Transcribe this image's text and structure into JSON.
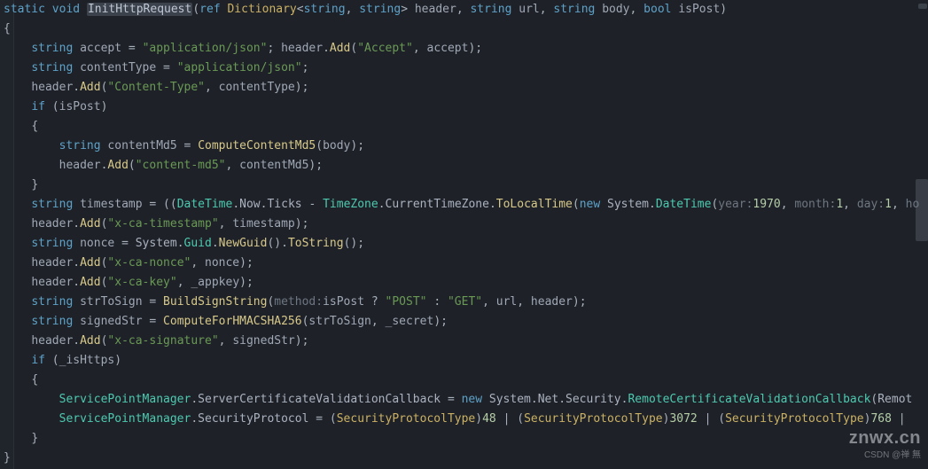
{
  "watermark": {
    "site": "znwx.cn",
    "credit": "CSDN @禅 無"
  },
  "hints": {
    "year": "year:",
    "month": "month:",
    "day": "day:",
    "method": "method:"
  },
  "code": {
    "l1": {
      "k_static": "static",
      "k_void": "void",
      "name": "InitHttpRequest",
      "op_op": "(",
      "k_ref": "ref",
      "t_dict": "Dictionary",
      "op_lt": "<",
      "t_s1": "string",
      "op_c": ",",
      "t_s2": "string",
      "op_gt": ">",
      "p_header": "header",
      "op_c2": ",",
      "t_s3": "string",
      "p_url": "url",
      "op_c3": ",",
      "t_s4": "string",
      "p_body": "body",
      "op_c4": ",",
      "t_bool": "bool",
      "p_isPost": "isPost",
      "op_cp": ")"
    },
    "l2": {
      "br": "{"
    },
    "l3": {
      "t": "string",
      "v": "accept",
      "eq": "=",
      "s": "\"application/json\"",
      "sc": ";",
      "h": "header",
      "dot": ".",
      "add": "Add",
      "op": "(",
      "s2": "\"Accept\"",
      "c": ",",
      "a2": "accept",
      "cp": ")",
      "sc2": ";"
    },
    "l4": {
      "t": "string",
      "v": "contentType",
      "eq": "=",
      "s": "\"application/json\"",
      "sc": ";"
    },
    "l5": {
      "h": "header",
      "dot": ".",
      "add": "Add",
      "op": "(",
      "s": "\"Content-Type\"",
      "c": ",",
      "v": "contentType",
      "cp": ")",
      "sc": ";"
    },
    "l6": {
      "k": "if",
      "op": "(",
      "v": "isPost",
      "cp": ")"
    },
    "l7": {
      "br": "{"
    },
    "l8": {
      "t": "string",
      "v": "contentMd5",
      "eq": "=",
      "fn": "ComputeContentMd5",
      "op": "(",
      "a": "body",
      "cp": ")",
      "sc": ";"
    },
    "l9": {
      "h": "header",
      "dot": ".",
      "add": "Add",
      "op": "(",
      "s": "\"content-md5\"",
      "c": ",",
      "v": "contentMd5",
      "cp": ")",
      "sc": ";"
    },
    "l10": {
      "br": "}"
    },
    "l11": {
      "t": "string",
      "v": "timestamp",
      "eq": "=",
      "op": "((",
      "dt": "DateTime",
      "d": ".",
      "now": "Now",
      "d2": ".",
      "ticks": "Ticks",
      "minus": "-",
      "tz": "TimeZone",
      "d3": ".",
      "cur": "CurrentTimeZone",
      "d4": ".",
      "tlt": "ToLocalTime",
      "op2": "(",
      "new": "new",
      "sp": " ",
      "sys": "System",
      "d5": ".",
      "dt2": "DateTime",
      "op3": "(",
      "y": "1970",
      "c1": ",",
      "m": "1",
      "c2": ",",
      "dd": "1",
      "c3": ",",
      "tail": "ho"
    },
    "l12": {
      "h": "header",
      "dot": ".",
      "add": "Add",
      "op": "(",
      "s": "\"x-ca-timestamp\"",
      "c": ",",
      "v": "timestamp",
      "cp": ")",
      "sc": ";"
    },
    "l13": {
      "t": "string",
      "v": "nonce",
      "eq": "=",
      "sys": "System",
      "d": ".",
      "guid": "Guid",
      "d2": ".",
      "ng": "NewGuid",
      "op": "()",
      "d3": ".",
      "ts": "ToString",
      "op2": "()",
      "sc": ";"
    },
    "l14": {
      "h": "header",
      "dot": ".",
      "add": "Add",
      "op": "(",
      "s": "\"x-ca-nonce\"",
      "c": ",",
      "v": "nonce",
      "cp": ")",
      "sc": ";"
    },
    "l15": {
      "h": "header",
      "dot": ".",
      "add": "Add",
      "op": "(",
      "s": "\"x-ca-key\"",
      "c": ",",
      "v": "_appkey",
      "cp": ")",
      "sc": ";"
    },
    "l16": {
      "t": "string",
      "v": "strToSign",
      "eq": "=",
      "fn": "BuildSignString",
      "op": "(",
      "ip": "isPost",
      "q": "?",
      "s1": "\"POST\"",
      "col": ":",
      "s2": "\"GET\"",
      "c1": ",",
      "u": "url",
      "c2": ",",
      "hd": "header",
      "cp": ")",
      "sc": ";"
    },
    "l17": {
      "t": "string",
      "v": "signedStr",
      "eq": "=",
      "fn": "ComputeForHMACSHA256",
      "op": "(",
      "a": "strToSign",
      "c": ",",
      "sec": "_secret",
      "cp": ")",
      "sc": ";"
    },
    "l18": {
      "h": "header",
      "dot": ".",
      "add": "Add",
      "op": "(",
      "s": "\"x-ca-signature\"",
      "c": ",",
      "v": "signedStr",
      "cp": ")",
      "sc": ";"
    },
    "l19": {
      "k": "if",
      "op": "(",
      "v": "_isHttps",
      "cp": ")"
    },
    "l20": {
      "br": "{"
    },
    "l21": {
      "spm": "ServicePointManager",
      "d": ".",
      "cb": "ServerCertificateValidationCallback",
      "eq": "=",
      "new": "new",
      "sp": " ",
      "sys": "System",
      "d2": ".",
      "net": "Net",
      "d3": ".",
      "sec": "Security",
      "d4": ".",
      "rcvc": "RemoteCertificateValidationCallback",
      "op": "(",
      "rem": "Remot"
    },
    "l22": {
      "spm": "ServicePointManager",
      "d": ".",
      "sp2": "SecurityProtocol",
      "eq": "=",
      "op": "(",
      "spt": "SecurityProtocolType",
      "cp": ")",
      "n1": "48",
      "bar": "|",
      "op2": "(",
      "spt2": "SecurityProtocolType",
      "cp2": ")",
      "n2": "3072",
      "bar2": "|",
      "op3": "(",
      "spt3": "SecurityProtocolType",
      "cp3": ")",
      "n3": "768",
      "bar3": "|"
    },
    "l23": {
      "br": "}"
    },
    "l24": {
      "br": "}"
    }
  }
}
